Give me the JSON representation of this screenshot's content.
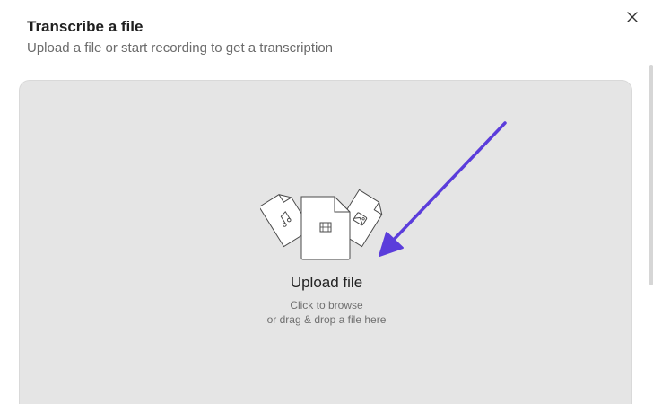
{
  "dialog": {
    "title": "Transcribe a file",
    "subtitle": "Upload a file or start recording to get a transcription"
  },
  "dropzone": {
    "title": "Upload file",
    "hint_line1": "Click to browse",
    "hint_line2": "or drag & drop a file here"
  },
  "icons": {
    "close": "close-icon",
    "audio_file": "audio-file-icon",
    "video_file": "video-file-icon",
    "image_file": "image-file-icon",
    "annotation_arrow": "arrow-annotation"
  },
  "colors": {
    "accent_arrow": "#5b3ddb",
    "dropzone_bg": "#e5e5e5"
  }
}
